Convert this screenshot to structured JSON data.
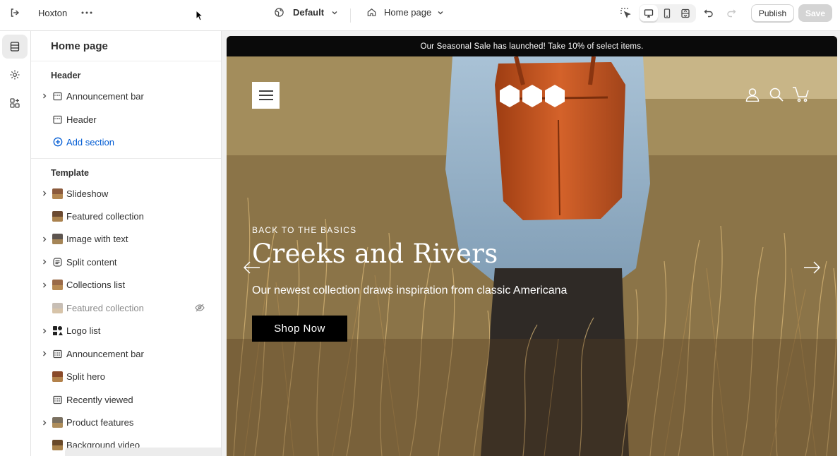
{
  "topbar": {
    "store_name": "Hoxton",
    "theme_label": "Default",
    "page_label": "Home page",
    "publish_label": "Publish",
    "save_label": "Save"
  },
  "sidebar": {
    "title": "Home page",
    "header_group": {
      "label": "Header",
      "items": [
        {
          "label": "Announcement bar",
          "expandable": true
        },
        {
          "label": "Header",
          "expandable": false
        }
      ],
      "add_label": "Add section"
    },
    "template_group": {
      "label": "Template",
      "items": [
        {
          "label": "Slideshow",
          "expandable": true
        },
        {
          "label": "Featured collection",
          "expandable": false
        },
        {
          "label": "Image with text",
          "expandable": true
        },
        {
          "label": "Split content",
          "expandable": true
        },
        {
          "label": "Collections list",
          "expandable": true
        },
        {
          "label": "Featured collection",
          "expandable": false,
          "hidden": true
        },
        {
          "label": "Logo list",
          "expandable": true
        },
        {
          "label": "Announcement bar",
          "expandable": true
        },
        {
          "label": "Split hero",
          "expandable": false
        },
        {
          "label": "Recently viewed",
          "expandable": false
        },
        {
          "label": "Product features",
          "expandable": true
        },
        {
          "label": "Background video",
          "expandable": false
        }
      ]
    }
  },
  "preview": {
    "announcement": "Our Seasonal Sale has launched! Take 10% of select items.",
    "hero": {
      "eyebrow": "BACK TO THE BASICS",
      "title": "Creeks and Rivers",
      "subtitle": "Our newest collection draws inspiration from classic Americana",
      "button_label": "Shop Now"
    }
  },
  "colors": {
    "accent_link": "#005bd3",
    "announcement_bg": "#0a0a0a",
    "backpack": "#c2501c"
  }
}
